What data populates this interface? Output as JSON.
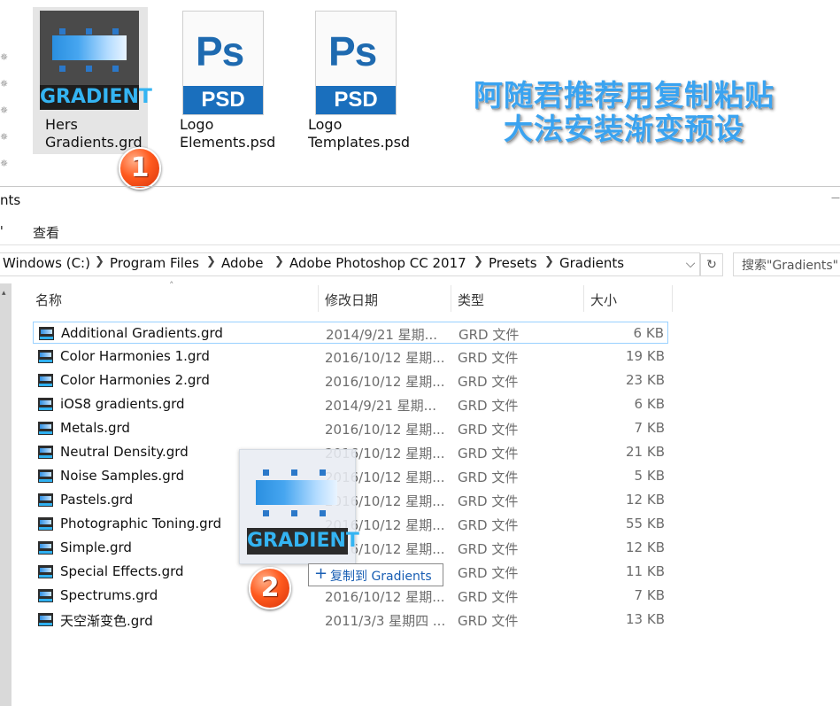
{
  "desktop": {
    "files": [
      {
        "name": "Hers\nGradients.grd",
        "icon": "gradient-file-icon",
        "thumb_word": "GRADIENT"
      },
      {
        "name": "Logo\nElements.psd",
        "icon": "psd-file-icon",
        "ps": "Ps",
        "band": "PSD"
      },
      {
        "name": "Logo\nTemplates.psd",
        "icon": "psd-file-icon",
        "ps": "Ps",
        "band": "PSD"
      }
    ],
    "headline_line1": "阿随君推荐用复制粘贴",
    "headline_line2": "大法安装渐变预设",
    "step1": "1",
    "step2": "2"
  },
  "window": {
    "title": "nts",
    "ribbon_tab_left": "\"",
    "ribbon_tab_view": "查看"
  },
  "address": {
    "crumbs": [
      "Windows (C:)",
      "Program Files",
      "Adobe",
      "Adobe Photoshop CC 2017",
      "Presets",
      "Gradients"
    ],
    "search_placeholder": "搜索\"Gradients\""
  },
  "columns": {
    "name": "名称",
    "date": "修改日期",
    "type": "类型",
    "size": "大小"
  },
  "files": [
    {
      "name": "Additional Gradients.grd",
      "date": "2014/9/21 星期...",
      "type": "GRD 文件",
      "size": "6 KB"
    },
    {
      "name": "Color Harmonies 1.grd",
      "date": "2016/10/12 星期...",
      "type": "GRD 文件",
      "size": "19 KB"
    },
    {
      "name": "Color Harmonies 2.grd",
      "date": "2016/10/12 星期...",
      "type": "GRD 文件",
      "size": "23 KB"
    },
    {
      "name": "iOS8 gradients.grd",
      "date": "2014/9/21 星期...",
      "type": "GRD 文件",
      "size": "6 KB"
    },
    {
      "name": "Metals.grd",
      "date": "2016/10/12 星期...",
      "type": "GRD 文件",
      "size": "7 KB"
    },
    {
      "name": "Neutral Density.grd",
      "date": "2016/10/12 星期...",
      "type": "GRD 文件",
      "size": "21 KB"
    },
    {
      "name": "Noise Samples.grd",
      "date": "2016/10/12 星期...",
      "type": "GRD 文件",
      "size": "5 KB"
    },
    {
      "name": "Pastels.grd",
      "date": "2016/10/12 星期...",
      "type": "GRD 文件",
      "size": "12 KB"
    },
    {
      "name": "Photographic Toning.grd",
      "date": "2016/10/12 星期...",
      "type": "GRD 文件",
      "size": "55 KB"
    },
    {
      "name": "Simple.grd",
      "date": "2016/10/12 星期...",
      "type": "GRD 文件",
      "size": "12 KB"
    },
    {
      "name": "Special Effects.grd",
      "date": "2016/10/12 星期...",
      "type": "GRD 文件",
      "size": "11 KB"
    },
    {
      "name": "Spectrums.grd",
      "date": "2016/10/12 星期...",
      "type": "GRD 文件",
      "size": "7 KB"
    },
    {
      "name": "天空渐变色.grd",
      "date": "2011/3/3 星期四 ...",
      "type": "GRD 文件",
      "size": "13 KB"
    }
  ],
  "drag": {
    "thumb_word": "GRADIENT",
    "tooltip": "复制到 Gradients",
    "tooltip_icon": "plus-icon"
  },
  "colors": {
    "accent_blue": "#3aa3f0",
    "badge_orange": "#ff5a1e",
    "selection": "#99d1ff"
  }
}
